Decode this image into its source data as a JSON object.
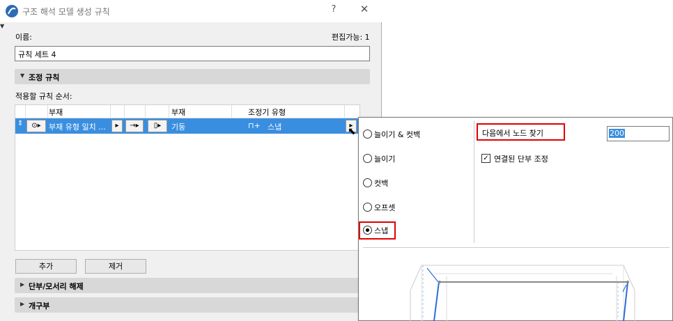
{
  "dialog": {
    "title": "구조 해석 모델 생성 규칙",
    "help": "?",
    "close": "✕",
    "name_label": "이름:",
    "edit_label": "편집가능: 1",
    "name_value": "규칙 세트 4",
    "section_rules": "조정 규칙",
    "order_label": "적용할 규칙 순서:",
    "table": {
      "headers": [
        "부재",
        "부재",
        "조정기 유형"
      ],
      "row": {
        "member1": "부재 유형 일치 ...",
        "arrow": "→",
        "member2": "기둥",
        "adjuster": "스냅"
      }
    },
    "add_button": "추가",
    "remove_button": "제거",
    "section_end": "단부/모서리 해제",
    "section_opening": "개구부"
  },
  "popup": {
    "options": [
      "늘이기 & 컷백",
      "늘이기",
      "컷백",
      "오프셋",
      "스냅"
    ],
    "selected": "스냅",
    "find_node_label": "다음에서 노드 찾기",
    "node_value": "200",
    "checkbox_label": "연결된 단부 조정",
    "checkbox_checked": true
  },
  "colors": {
    "selection": "#3a8ee0",
    "highlight_box": "#e00000",
    "section_bg": "#d8d8d8"
  }
}
